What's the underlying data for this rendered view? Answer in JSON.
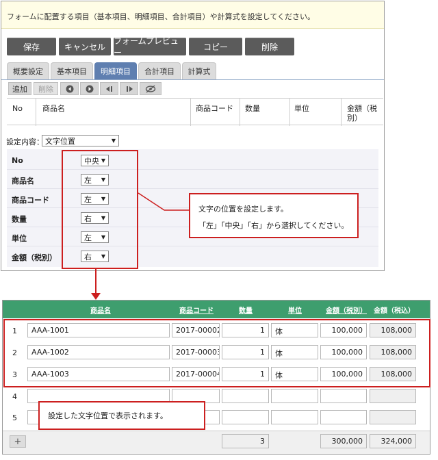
{
  "notice": "フォームに配置する項目（基本項目、明細項目、合計項目）や計算式を設定してください。",
  "toolbar": {
    "save": "保存",
    "cancel": "キャンセル",
    "preview": "フォームプレビュー",
    "copy": "コピー",
    "delete": "削除"
  },
  "tabs": [
    "概要設定",
    "基本項目",
    "明細項目",
    "合計項目",
    "計算式"
  ],
  "active_tab": "明細項目",
  "item_tools": {
    "add": "追加",
    "remove": "削除"
  },
  "detail_headers": {
    "no": "No",
    "name": "商品名",
    "code": "商品コード",
    "qty": "数量",
    "unit": "単位",
    "amount": "金額（税別）"
  },
  "setting": {
    "label": "設定内容：",
    "value": "文字位置"
  },
  "alignment_rows": [
    {
      "label": "No",
      "value": "中央"
    },
    {
      "label": "商品名",
      "value": "左"
    },
    {
      "label": "商品コード",
      "value": "左"
    },
    {
      "label": "数量",
      "value": "右"
    },
    {
      "label": "単位",
      "value": "左"
    },
    {
      "label": "金額（税別）",
      "value": "右"
    }
  ],
  "callout_top": {
    "line1": "文字の位置を設定します。",
    "line2": "「左」「中央」「右」から選択してください。"
  },
  "grid_headers": {
    "name": "商品名",
    "code": "商品コード",
    "qty": "数量",
    "unit": "単位",
    "excl": "金額（税別）",
    "incl": "金額（税込）"
  },
  "grid_rows": [
    {
      "no": "1",
      "name": "AAA-1001",
      "code": "2017-00002",
      "qty": "1",
      "unit": "体",
      "excl": "100,000",
      "incl": "108,000"
    },
    {
      "no": "2",
      "name": "AAA-1002",
      "code": "2017-00003",
      "qty": "1",
      "unit": "体",
      "excl": "100,000",
      "incl": "108,000"
    },
    {
      "no": "3",
      "name": "AAA-1003",
      "code": "2017-00004",
      "qty": "1",
      "unit": "体",
      "excl": "100,000",
      "incl": "108,000"
    },
    {
      "no": "4",
      "name": "",
      "code": "",
      "qty": "",
      "unit": "",
      "excl": "",
      "incl": ""
    },
    {
      "no": "5",
      "name": "",
      "code": "",
      "qty": "",
      "unit": "",
      "excl": "",
      "incl": ""
    }
  ],
  "callout_bottom": "設定した文字位置で表示されます。",
  "totals": {
    "add": "+",
    "qty": "3",
    "excl": "300,000",
    "incl": "324,000"
  },
  "colors": {
    "accent_red": "#cc1f1f",
    "tab_active": "#5f7fb0",
    "grid_header": "#3e9e6e",
    "toolbar": "#5b5b5b"
  }
}
